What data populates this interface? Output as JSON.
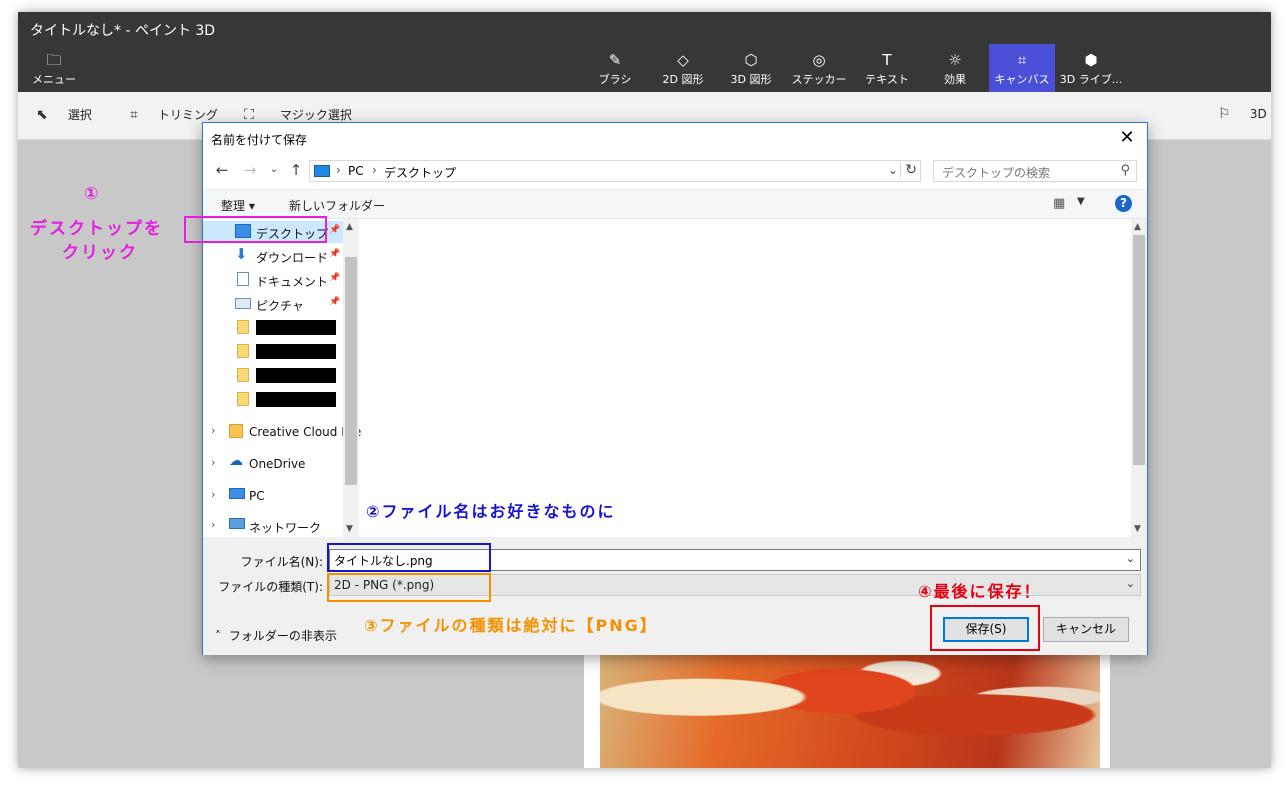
{
  "app": {
    "title": "タイトルなし* - ペイント 3D",
    "menu_label": "メニュー",
    "tools": [
      {
        "icon": "brush-icon",
        "glyph": "✎",
        "label": "ブラシ"
      },
      {
        "icon": "2d-shapes-icon",
        "glyph": "◇",
        "label": "2D 図形"
      },
      {
        "icon": "3d-shapes-icon",
        "glyph": "⬡",
        "label": "3D 図形"
      },
      {
        "icon": "stickers-icon",
        "glyph": "◎",
        "label": "ステッカー"
      },
      {
        "icon": "text-icon",
        "glyph": "T",
        "label": "テキスト"
      },
      {
        "icon": "effects-icon",
        "glyph": "☼",
        "label": "効果"
      },
      {
        "icon": "canvas-icon",
        "glyph": "⌗",
        "label": "キャンバス"
      },
      {
        "icon": "3d-library-icon",
        "glyph": "⬢",
        "label": "3D ライブ..."
      }
    ],
    "active_tool": "キャンバス",
    "subtools": {
      "select": "選択",
      "crop": "トリミング",
      "magic_select": "マジック選択",
      "view3d": "3D"
    }
  },
  "dialog": {
    "title": "名前を付けて保存",
    "breadcrumb": [
      "PC",
      "デスクトップ"
    ],
    "search_placeholder": "デスクトップの検索",
    "organize": "整理 ▾",
    "new_folder": "新しいフォルダー",
    "help": "?",
    "nav_items": [
      {
        "label": "デスクトップ",
        "selected": true,
        "icon": "desktop-icon"
      },
      {
        "label": "ダウンロード",
        "icon": "download-icon"
      },
      {
        "label": "ドキュメント",
        "icon": "document-icon"
      },
      {
        "label": "ピクチャ",
        "icon": "pictures-icon"
      }
    ],
    "nav_groups": [
      {
        "label": "Creative Cloud File",
        "icon": "creative-cloud-icon"
      },
      {
        "label": "OneDrive",
        "icon": "onedrive-icon"
      },
      {
        "label": "PC",
        "icon": "pc-icon"
      },
      {
        "label": "ネットワーク",
        "icon": "network-icon"
      }
    ],
    "filename_label": "ファイル名(N):",
    "filename_value": "タイトルなし.png",
    "filetype_label": "ファイルの種類(T):",
    "filetype_value": "2D - PNG (*.png)",
    "hide_folders": "フォルダーの非表示",
    "save_button": "保存(S)",
    "cancel_button": "キャンセル"
  },
  "annotations": {
    "step1_num": "①",
    "step1_line1": "デスクトップを",
    "step1_line2": "クリック",
    "step2": "②ファイル名はお好きなものに",
    "step3": "③ファイルの種類は絶対に【PNG】",
    "step4": "④最後に保存！",
    "colors": {
      "step1": "#e61ee0",
      "step2": "#1515d0",
      "step3": "#f39200",
      "step4": "#e60012"
    }
  }
}
